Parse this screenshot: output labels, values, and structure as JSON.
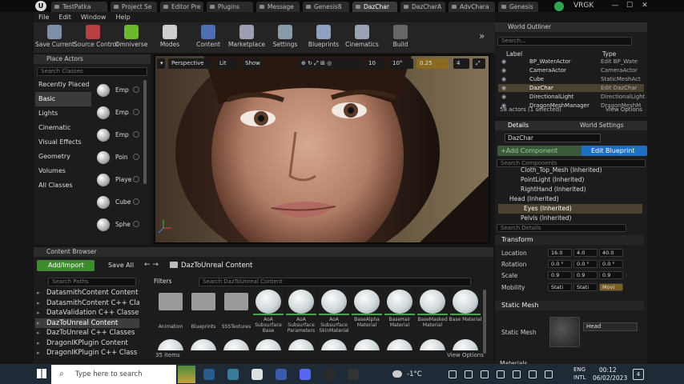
{
  "tabs": [
    {
      "label": "TestPatka"
    },
    {
      "label": "Project Se"
    },
    {
      "label": "Editor Pre"
    },
    {
      "label": "Plugins"
    },
    {
      "label": "Message"
    },
    {
      "label": "Genesis8"
    },
    {
      "label": "DazChar"
    },
    {
      "label": "DazCharA"
    },
    {
      "label": "AdvChara"
    },
    {
      "label": "Genesis"
    }
  ],
  "window": {
    "user": "VRGK",
    "minimize": "—",
    "maximize": "☐",
    "close": "✕"
  },
  "menu": [
    "File",
    "Edit",
    "Window",
    "Help"
  ],
  "toolbar": [
    {
      "label": "Save Current",
      "icon": "save-icon",
      "color": "#7f8fa8"
    },
    {
      "label": "Source Control",
      "icon": "source-control-icon",
      "color": "#b84040"
    },
    {
      "label": "Omniverse",
      "icon": "omniverse-icon",
      "color": "#6cb82e"
    },
    {
      "label": "Modes",
      "icon": "modes-icon",
      "color": "#cfcfcf"
    },
    {
      "label": "Content",
      "icon": "content-icon",
      "color": "#4b6fb0"
    },
    {
      "label": "Marketplace",
      "icon": "marketplace-icon",
      "color": "#9aa0b0"
    },
    {
      "label": "Settings",
      "icon": "settings-icon",
      "color": "#8a9aa8"
    },
    {
      "label": "Blueprints",
      "icon": "blueprints-icon",
      "color": "#8fa0c0"
    },
    {
      "label": "Cinematics",
      "icon": "cinematics-icon",
      "color": "#9aa4b4"
    },
    {
      "label": "Build",
      "icon": "build-icon",
      "color": "#666666"
    }
  ],
  "place_actors": {
    "title": "Place Actors",
    "search_placeholder": "Search Classes",
    "categories": [
      "Recently Placed",
      "Basic",
      "Lights",
      "Cinematic",
      "Visual Effects",
      "Geometry",
      "Volumes",
      "All Classes"
    ],
    "selected_category": "Basic",
    "items": [
      "Emp",
      "Emp",
      "Emp",
      "Poin",
      "Playe",
      "Cube",
      "Sphe"
    ]
  },
  "viewport": {
    "perspective": "Perspective",
    "lit": "Lit",
    "show": "Show",
    "snap_grid": "10",
    "snap_angle": "10°",
    "snap_scale": "0.25",
    "cam_speed": "4"
  },
  "content_browser": {
    "title": "Content Browser",
    "add_import": "Add/Import",
    "save_all": "Save All",
    "path": "DazToUnreal Content",
    "search_paths": "Search Paths",
    "filters": "Filters",
    "search_content": "Search DazToUnreal Content",
    "tree": [
      "DatasmithContent Content",
      "DatasmithContent C++ Cla",
      "DataValidation C++ Classe",
      "DazToUnreal Content",
      "DazToUnreal C++ Classes",
      "DragonIKPlugin Content",
      "DragonIKPlugin C++ Class"
    ],
    "selected_tree": "DazToUnreal Content",
    "folders": [
      "Animation",
      "Blueprints",
      "SSSTextures"
    ],
    "assets": [
      {
        "label": "AoA Subsurface Base"
      },
      {
        "label": "AoA Subsurface Parameters"
      },
      {
        "label": "AoA Subsurface SkinMaterial"
      },
      {
        "label": "BaseAlpha Material"
      },
      {
        "label": "BaseHair Material"
      },
      {
        "label": "BaseMasked Material"
      },
      {
        "label": "Base Material"
      }
    ],
    "items_count": "35 items",
    "view_options": "View Options"
  },
  "outliner": {
    "title": "World Outliner",
    "search_placeholder": "Search...",
    "col_label": "Label",
    "col_type": "Type",
    "rows": [
      {
        "name": "BP_WaterActor",
        "type": "Edit BP_Wate"
      },
      {
        "name": "CameraActor",
        "type": "CameraActor"
      },
      {
        "name": "Cube",
        "type": "StaticMeshAct"
      },
      {
        "name": "DazChar",
        "type": "Edit DazChar"
      },
      {
        "name": "DirectionalLight",
        "type": "DirectionalLight"
      },
      {
        "name": "DragonMeshManager",
        "type": "DragonMeshM"
      }
    ],
    "selected": "DazChar",
    "status": "58 actors (1 selected)",
    "view_options": "View Options"
  },
  "details": {
    "tab_details": "Details",
    "tab_world": "World Settings",
    "name_value": "DazChar",
    "add_component": "+Add Component",
    "edit_blueprint": "Edit Blueprint",
    "search_components": "Search Components",
    "components": [
      "Cloth_Top_Mesh (Inherited)",
      "PointLight (Inherited)",
      "RightHand (Inherited)",
      "Head (Inherited)",
      "Eyes (Inherited)",
      "Pelvis (Inherited)"
    ],
    "selected_component": "Eyes (Inherited)",
    "search_details": "Search Details",
    "transform_title": "Transform",
    "location_label": "Location",
    "location": [
      "16.0",
      "4.0",
      "40.0"
    ],
    "rotation_label": "Rotation",
    "rotation": [
      "0.0 °",
      "0.0 °",
      "0.0 °"
    ],
    "scale_label": "Scale",
    "scale": [
      "0.9",
      "0.9",
      "0.9"
    ],
    "mobility_label": "Mobility",
    "mobility": [
      "Stati",
      "Stati",
      "Movi"
    ],
    "static_mesh_title": "Static Mesh",
    "static_mesh_label": "Static Mesh",
    "mesh_value": "Head",
    "materials_title": "Materials"
  },
  "taskbar": {
    "search": "Type here to search",
    "weather": "-1°C",
    "lang1": "ENG",
    "lang2": "INTL",
    "time": "00:12",
    "date": "06/02/2023",
    "notif": "4"
  }
}
